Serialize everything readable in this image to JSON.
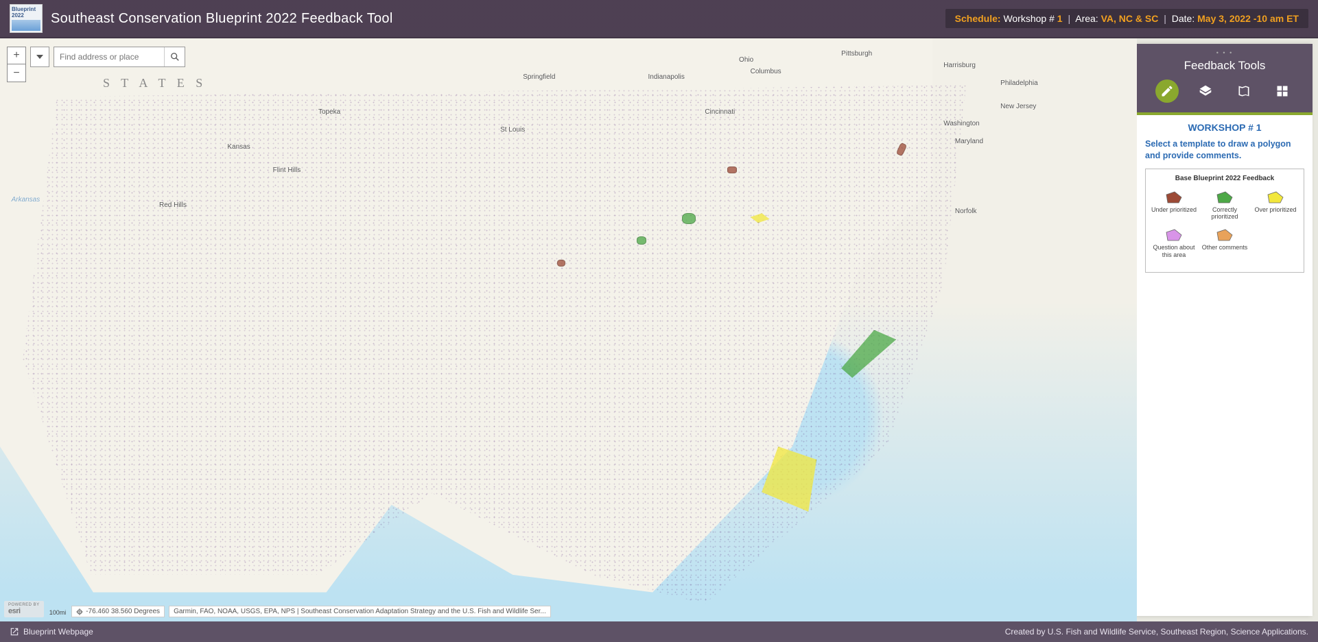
{
  "header": {
    "logo_text": "Blueprint 2022",
    "title": "Southeast Conservation Blueprint 2022 Feedback Tool",
    "schedule": {
      "schedule_label": "Schedule:",
      "workshop_label": "Workshop #",
      "workshop_num": "1",
      "area_label": "Area:",
      "area_value": "VA, NC & SC",
      "date_label": "Date:",
      "date_value": "May 3, 2022 -10 am ET"
    }
  },
  "map": {
    "search_placeholder": "Find address or place",
    "coords": "-76.460 38.560 Degrees",
    "scale": "100mi",
    "esri_powered": "POWERED BY",
    "esri": "esri",
    "attribution": "Garmin, FAO, NOAA, USGS, EPA, NPS | Southeast Conservation Adaptation Strategy and the U.S. Fish and Wildlife Ser...",
    "state_text": "S T A T E S",
    "cities": {
      "springfield": "Springfield",
      "indianapolis": "Indianapolis",
      "ohio": "Ohio",
      "columbus": "Columbus",
      "pittsburgh": "Pittsburgh",
      "harrisburg": "Harrisburg",
      "philadelphia": "Philadelphia",
      "washington": "Washington",
      "maryland": "Maryland",
      "cincinnati": "Cincinnati",
      "stlouis": "St Louis",
      "topeka": "Topeka",
      "kansas": "Kansas",
      "flint": "Flint Hills",
      "redhills": "Red Hills",
      "newjersey": "New Jersey",
      "norfolk": "Norfolk",
      "arkansas": "Arkansas"
    }
  },
  "panel": {
    "title": "Feedback Tools",
    "workshop_heading": "WORKSHOP # 1",
    "instruction": "Select a template to draw a polygon and provide comments.",
    "template_group_title": "Base Blueprint 2022 Feedback",
    "templates": [
      {
        "label": "Under prioritized",
        "color": "#9c4a36"
      },
      {
        "label": "Correctly prioritized",
        "color": "#4da847"
      },
      {
        "label": "Over prioritized",
        "color": "#f2e73c"
      },
      {
        "label": "Question about this area",
        "color": "#d894e8"
      },
      {
        "label": "Other comments",
        "color": "#e8a25a"
      }
    ]
  },
  "footer": {
    "link": "Blueprint Webpage",
    "credit": "Created by U.S. Fish and Wildlife Service, Southeast Region, Science Applications."
  }
}
